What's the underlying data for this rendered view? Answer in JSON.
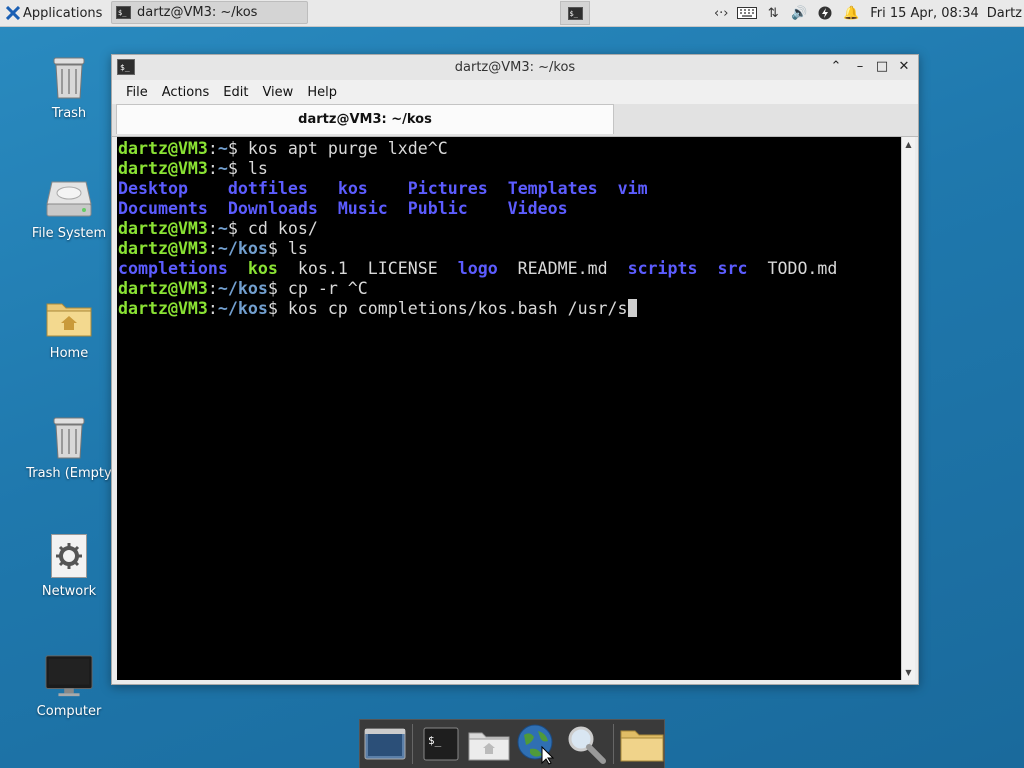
{
  "top_panel": {
    "applications_label": "Applications",
    "task_title": "dartz@VM3: ~/kos",
    "clock": "Fri 15 Apr, 08:34",
    "user": "Dartz"
  },
  "desktop_icons": [
    {
      "label": "Trash",
      "icon": "trash-icon"
    },
    {
      "label": "File System",
      "icon": "drive-icon"
    },
    {
      "label": "Home",
      "icon": "home-folder-icon"
    },
    {
      "label": "Trash (Empty",
      "icon": "trash-icon"
    },
    {
      "label": "Network",
      "icon": "network-icon"
    },
    {
      "label": "Computer",
      "icon": "monitor-icon"
    }
  ],
  "window": {
    "title": "dartz@VM3: ~/kos",
    "menu": [
      "File",
      "Actions",
      "Edit",
      "View",
      "Help"
    ],
    "tab_title": "dartz@VM3: ~/kos"
  },
  "terminal": {
    "prompt_user": "dartz@VM3",
    "line1_cmd": "kos apt purge lxde^C",
    "line2_cmd": "ls",
    "ls_home_row1": [
      "Desktop",
      "dotfiles",
      "kos",
      "Pictures",
      "Templates",
      "vim"
    ],
    "ls_home_row2": [
      "Documents",
      "Downloads",
      "Music",
      "Public",
      "Videos"
    ],
    "line5_cmd": "cd kos/",
    "line6_cmd": "ls",
    "ls_kos": [
      "completions",
      "kos",
      "kos.1",
      "LICENSE",
      "logo",
      "README.md",
      "scripts",
      "src",
      "TODO.md"
    ],
    "line8_cmd": "cp -r ^C",
    "line9_cmd": "kos cp completions/kos.bash /usr/s"
  },
  "colors": {
    "desktop_bg": "#1f78ad",
    "prompt_green": "#8ae234",
    "path_blue": "#729fcf",
    "dir_blue": "#5c5cff"
  }
}
